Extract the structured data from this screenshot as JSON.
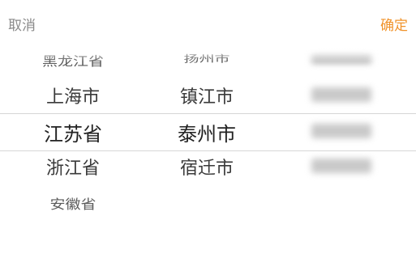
{
  "toolbar": {
    "cancel_label": "取消",
    "confirm_label": "确定",
    "confirm_color": "#f0932b",
    "cancel_color": "#8a8a8a"
  },
  "picker": {
    "province_column": {
      "items": [
        "黑龙江省",
        "上海市",
        "江苏省",
        "浙江省",
        "安徽省"
      ],
      "selected": "江苏省"
    },
    "city_column": {
      "items": [
        "扬州市",
        "镇江市",
        "泰州市",
        "宿迁市"
      ],
      "selected": "泰州市"
    },
    "district_column": {
      "state": "blurred",
      "rows": 4
    }
  }
}
